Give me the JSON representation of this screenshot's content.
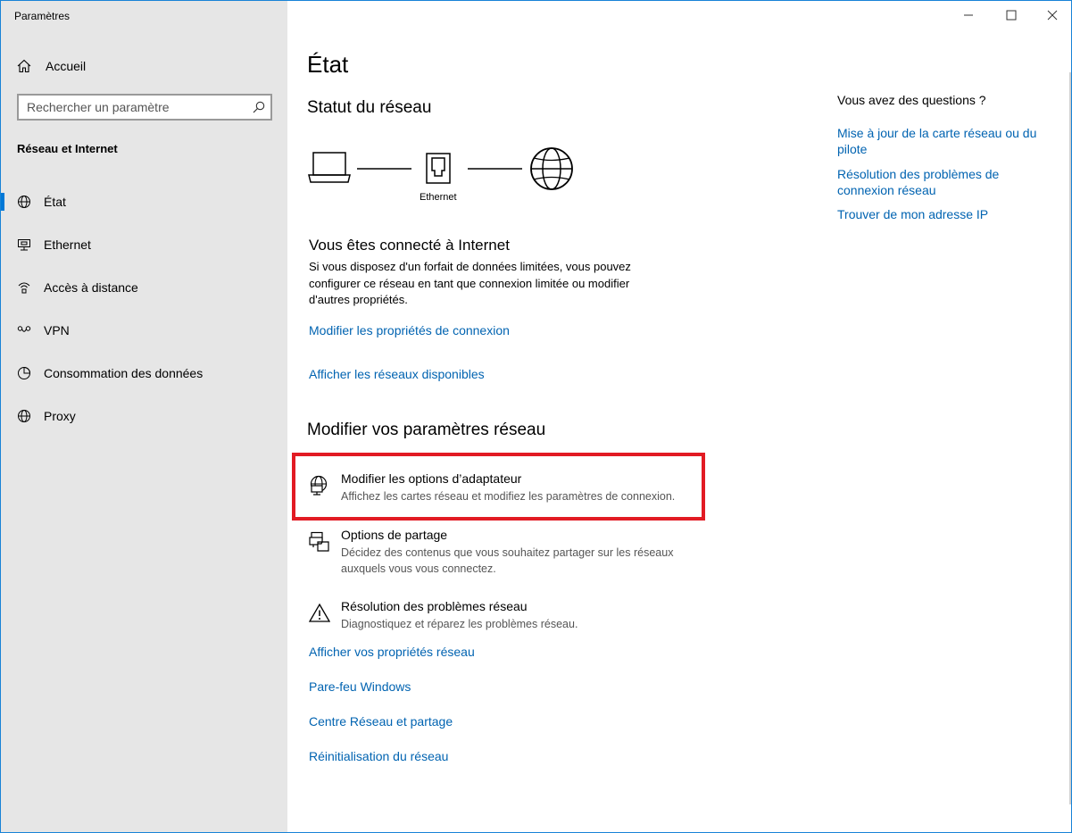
{
  "window": {
    "title": "Paramètres",
    "controls": [
      "minimize",
      "maximize",
      "close"
    ]
  },
  "sidebar": {
    "home_label": "Accueil",
    "search_placeholder": "Rechercher un paramètre",
    "section_title": "Réseau et Internet",
    "items": [
      {
        "label": "État",
        "icon": "globe-icon",
        "active": true
      },
      {
        "label": "Ethernet",
        "icon": "ethernet-icon",
        "active": false
      },
      {
        "label": "Accès à distance",
        "icon": "dialup-icon",
        "active": false
      },
      {
        "label": "VPN",
        "icon": "vpn-icon",
        "active": false
      },
      {
        "label": "Consommation des données",
        "icon": "data-usage-icon",
        "active": false
      },
      {
        "label": "Proxy",
        "icon": "globe-icon",
        "active": false
      }
    ]
  },
  "main": {
    "title": "État",
    "network_status_heading": "Statut du réseau",
    "diagram_label": "Ethernet",
    "connected_heading": "Vous êtes connecté à Internet",
    "connected_desc": "Si vous disposez d'un forfait de données limitées, vous pouvez configurer ce réseau en tant que connexion limitée ou modifier d'autres propriétés.",
    "link_properties": "Modifier les propriétés de connexion",
    "link_networks": "Afficher les réseaux disponibles",
    "change_heading": "Modifier vos paramètres réseau",
    "options": [
      {
        "title": "Modifier les options d’adaptateur",
        "desc": "Affichez les cartes réseau et modifiez les paramètres de connexion.",
        "icon": "adapter-icon"
      },
      {
        "title": "Options de partage",
        "desc": "Décidez des contenus que vous souhaitez partager sur les réseaux auxquels vous vous connectez.",
        "icon": "sharing-icon"
      },
      {
        "title": "Résolution des problèmes réseau",
        "desc": "Diagnostiquez et réparez les problèmes réseau.",
        "icon": "warning-icon"
      }
    ],
    "bottom_links": [
      "Afficher vos propriétés réseau",
      "Pare-feu Windows",
      "Centre Réseau et partage",
      "Réinitialisation du réseau"
    ]
  },
  "right": {
    "questions_title": "Vous avez des questions ?",
    "links": [
      "Mise à jour de la carte réseau ou du pilote",
      "Résolution des problèmes de connexion réseau",
      "Trouver de mon adresse IP"
    ]
  },
  "colors": {
    "accent": "#0078d7",
    "link": "#0063b1",
    "highlight": "#e21b23",
    "sidebar_bg": "#e6e6e6"
  }
}
